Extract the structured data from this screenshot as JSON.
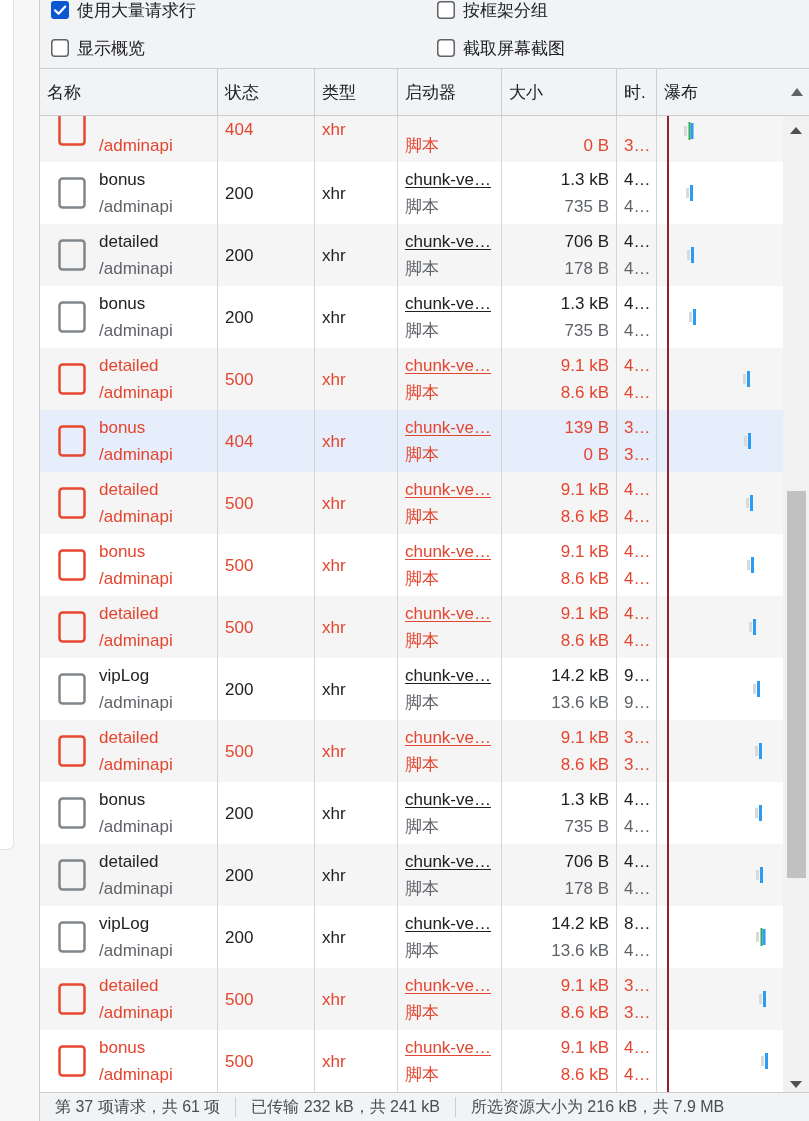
{
  "settings": [
    {
      "label": "使用大量请求行",
      "checked": true
    },
    {
      "label": "按框架分组",
      "checked": false
    },
    {
      "label": "显示概览",
      "checked": false
    },
    {
      "label": "截取屏幕截图",
      "checked": false
    }
  ],
  "table": {
    "columns": [
      {
        "label": "名称",
        "sorted": false
      },
      {
        "label": "状态",
        "sorted": false
      },
      {
        "label": "类型",
        "sorted": false
      },
      {
        "label": "启动器",
        "sorted": false
      },
      {
        "label": "大小",
        "sorted": false
      },
      {
        "label": "时.",
        "sorted": false
      },
      {
        "label": "瀑布",
        "sorted": true
      }
    ],
    "partial_row": {
      "path": "/adminapi",
      "status": "404",
      "type": "xhr",
      "initiator_type": "脚本",
      "resource_size": "0 B",
      "time_2": "3…",
      "error": true
    },
    "rows": [
      {
        "name": "bonus",
        "path": "/adminapi",
        "status": "200",
        "type": "xhr",
        "initiator": "chunk-ve…",
        "initiator_type": "脚本",
        "transferred": "1.3 kB",
        "resource_size": "735 B",
        "time": "4…",
        "time_2": "4…",
        "error": false,
        "hovered": false
      },
      {
        "name": "detailed",
        "path": "/adminapi",
        "status": "200",
        "type": "xhr",
        "initiator": "chunk-ve…",
        "initiator_type": "脚本",
        "transferred": "706 B",
        "resource_size": "178 B",
        "time": "4…",
        "time_2": "4…",
        "error": false,
        "hovered": false
      },
      {
        "name": "bonus",
        "path": "/adminapi",
        "status": "200",
        "type": "xhr",
        "initiator": "chunk-ve…",
        "initiator_type": "脚本",
        "transferred": "1.3 kB",
        "resource_size": "735 B",
        "time": "4…",
        "time_2": "4…",
        "error": false,
        "hovered": false
      },
      {
        "name": "detailed",
        "path": "/adminapi",
        "status": "500",
        "type": "xhr",
        "initiator": "chunk-ve…",
        "initiator_type": "脚本",
        "transferred": "9.1 kB",
        "resource_size": "8.6 kB",
        "time": "4…",
        "time_2": "4…",
        "error": true,
        "hovered": false
      },
      {
        "name": "bonus",
        "path": "/adminapi",
        "status": "404",
        "type": "xhr",
        "initiator": "chunk-ve…",
        "initiator_type": "脚本",
        "transferred": "139 B",
        "resource_size": "0 B",
        "time": "3…",
        "time_2": "3…",
        "error": true,
        "hovered": true
      },
      {
        "name": "detailed",
        "path": "/adminapi",
        "status": "500",
        "type": "xhr",
        "initiator": "chunk-ve…",
        "initiator_type": "脚本",
        "transferred": "9.1 kB",
        "resource_size": "8.6 kB",
        "time": "4…",
        "time_2": "4…",
        "error": true,
        "hovered": false
      },
      {
        "name": "bonus",
        "path": "/adminapi",
        "status": "500",
        "type": "xhr",
        "initiator": "chunk-ve…",
        "initiator_type": "脚本",
        "transferred": "9.1 kB",
        "resource_size": "8.6 kB",
        "time": "4…",
        "time_2": "4…",
        "error": true,
        "hovered": false
      },
      {
        "name": "detailed",
        "path": "/adminapi",
        "status": "500",
        "type": "xhr",
        "initiator": "chunk-ve…",
        "initiator_type": "脚本",
        "transferred": "9.1 kB",
        "resource_size": "8.6 kB",
        "time": "4…",
        "time_2": "4…",
        "error": true,
        "hovered": false
      },
      {
        "name": "vipLog",
        "path": "/adminapi",
        "status": "200",
        "type": "xhr",
        "initiator": "chunk-ve…",
        "initiator_type": "脚本",
        "transferred": "14.2 kB",
        "resource_size": "13.6 kB",
        "time": "9…",
        "time_2": "9…",
        "error": false,
        "hovered": false
      },
      {
        "name": "detailed",
        "path": "/adminapi",
        "status": "500",
        "type": "xhr",
        "initiator": "chunk-ve…",
        "initiator_type": "脚本",
        "transferred": "9.1 kB",
        "resource_size": "8.6 kB",
        "time": "3…",
        "time_2": "3…",
        "error": true,
        "hovered": false
      },
      {
        "name": "bonus",
        "path": "/adminapi",
        "status": "200",
        "type": "xhr",
        "initiator": "chunk-ve…",
        "initiator_type": "脚本",
        "transferred": "1.3 kB",
        "resource_size": "735 B",
        "time": "4…",
        "time_2": "4…",
        "error": false,
        "hovered": false
      },
      {
        "name": "detailed",
        "path": "/adminapi",
        "status": "200",
        "type": "xhr",
        "initiator": "chunk-ve…",
        "initiator_type": "脚本",
        "transferred": "706 B",
        "resource_size": "178 B",
        "time": "4…",
        "time_2": "4…",
        "error": false,
        "hovered": false
      },
      {
        "name": "vipLog",
        "path": "/adminapi",
        "status": "200",
        "type": "xhr",
        "initiator": "chunk-ve…",
        "initiator_type": "脚本",
        "transferred": "14.2 kB",
        "resource_size": "13.6 kB",
        "time": "8…",
        "time_2": "4…",
        "error": false,
        "hovered": false
      },
      {
        "name": "detailed",
        "path": "/adminapi",
        "status": "500",
        "type": "xhr",
        "initiator": "chunk-ve…",
        "initiator_type": "脚本",
        "transferred": "9.1 kB",
        "resource_size": "8.6 kB",
        "time": "3…",
        "time_2": "3…",
        "error": true,
        "hovered": false
      },
      {
        "name": "bonus",
        "path": "/adminapi",
        "status": "500",
        "type": "xhr",
        "initiator": "chunk-ve…",
        "initiator_type": "脚本",
        "transferred": "9.1 kB",
        "resource_size": "8.6 kB",
        "time": "4…",
        "time_2": "4…",
        "error": true,
        "hovered": false
      }
    ]
  },
  "status_bar": [
    "第 37 项请求，共 61 项",
    "已传输 232 kB，共 241 kB",
    "所选资源大小为 216 kB，共 7.9 MB"
  ]
}
